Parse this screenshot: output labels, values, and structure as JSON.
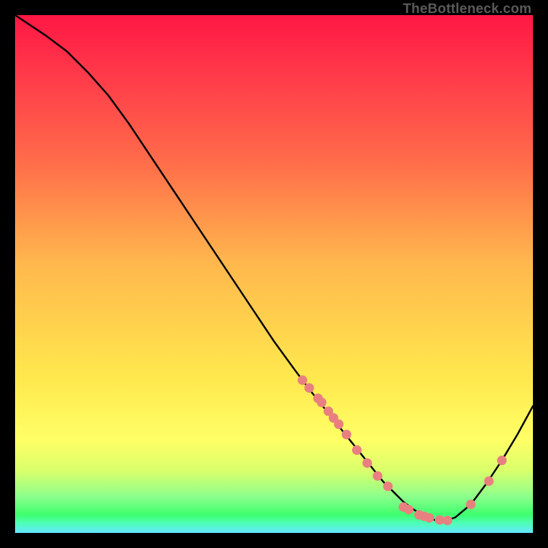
{
  "watermark": "TheBottleneck.com",
  "chart_data": {
    "type": "line",
    "title": "",
    "xlabel": "",
    "ylabel": "",
    "xlim": [
      0,
      100
    ],
    "ylim": [
      0,
      100
    ],
    "series": [
      {
        "name": "curve",
        "x": [
          0,
          6,
          10,
          14,
          18,
          22,
          26,
          30,
          34,
          38,
          42,
          46,
          50,
          54,
          57,
          59,
          61,
          63,
          65,
          67,
          69,
          71,
          73,
          75,
          77,
          79,
          81,
          83,
          85,
          88,
          91,
          94,
          97,
          100
        ],
        "y": [
          100,
          96,
          93,
          89,
          84.5,
          79,
          73,
          67,
          61,
          55,
          49,
          43,
          37,
          31.5,
          27.5,
          25,
          22.5,
          20,
          17.5,
          15,
          12.5,
          10,
          8,
          6,
          4.5,
          3.3,
          2.5,
          2.3,
          3.0,
          5.5,
          9.5,
          14,
          19,
          24.5
        ]
      }
    ],
    "scatter": [
      {
        "name": "points",
        "color": "#e98080",
        "radius": 7,
        "points": [
          {
            "x": 55.5,
            "y": 29.5
          },
          {
            "x": 56.8,
            "y": 28
          },
          {
            "x": 58.5,
            "y": 26
          },
          {
            "x": 59.2,
            "y": 25.2
          },
          {
            "x": 60.5,
            "y": 23.5
          },
          {
            "x": 61.5,
            "y": 22.2
          },
          {
            "x": 62.5,
            "y": 21
          },
          {
            "x": 64.0,
            "y": 19
          },
          {
            "x": 66.0,
            "y": 16
          },
          {
            "x": 68.0,
            "y": 13.5
          },
          {
            "x": 70.0,
            "y": 11
          },
          {
            "x": 72.0,
            "y": 9
          },
          {
            "x": 75.0,
            "y": 5
          },
          {
            "x": 76.0,
            "y": 4.5
          },
          {
            "x": 78.0,
            "y": 3.5
          },
          {
            "x": 79.0,
            "y": 3.2
          },
          {
            "x": 80.0,
            "y": 2.9
          },
          {
            "x": 82.0,
            "y": 2.5
          },
          {
            "x": 83.5,
            "y": 2.4
          },
          {
            "x": 88.0,
            "y": 5.5
          },
          {
            "x": 91.5,
            "y": 10
          },
          {
            "x": 94.0,
            "y": 14
          }
        ]
      }
    ]
  }
}
